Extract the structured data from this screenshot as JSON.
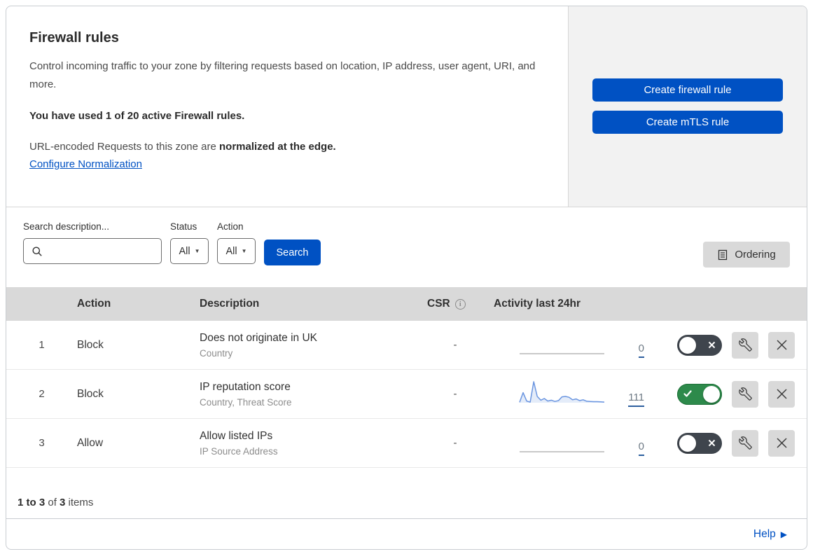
{
  "panel": {
    "title": "Firewall rules",
    "description": "Control incoming traffic to your zone by filtering requests based on location, IP address, user agent, URI, and more.",
    "usage": "You have used 1 of 20 active Firewall rules.",
    "normalization_text": "URL-encoded Requests to this zone are ",
    "normalization_bold": "normalized at the edge.",
    "normalization_link": "Configure Normalization",
    "create_firewall_label": "Create firewall rule",
    "create_mtls_label": "Create mTLS rule"
  },
  "filters": {
    "search_label": "Search description...",
    "status_label": "Status",
    "status_value": "All",
    "action_label": "Action",
    "action_value": "All",
    "search_button": "Search",
    "ordering_button": "Ordering"
  },
  "table": {
    "headers": {
      "action": "Action",
      "description": "Description",
      "csr": "CSR",
      "activity": "Activity last 24hr"
    },
    "rows": [
      {
        "num": "1",
        "action": "Block",
        "title": "Does not originate in UK",
        "subtitle": "Country",
        "csr": "-",
        "count": "0",
        "enabled": false,
        "activity_values": []
      },
      {
        "num": "2",
        "action": "Block",
        "title": "IP reputation score",
        "subtitle": "Country, Threat Score",
        "csr": "-",
        "count": "111",
        "enabled": true,
        "activity_values": [
          2,
          48,
          8,
          3,
          100,
          30,
          12,
          20,
          8,
          12,
          6,
          10,
          28,
          30,
          26,
          14,
          18,
          10,
          14,
          7,
          6,
          5,
          5,
          4,
          3
        ]
      },
      {
        "num": "3",
        "action": "Allow",
        "title": "Allow listed IPs",
        "subtitle": "IP Source Address",
        "csr": "-",
        "count": "0",
        "enabled": false,
        "activity_values": []
      }
    ]
  },
  "footer": {
    "range_bold": "1 to 3",
    "of_text": " of ",
    "total_bold": "3",
    "items_text": " items"
  },
  "help_label": "Help",
  "colors": {
    "accent_blue": "#0051c3",
    "toggle_on_green": "#2d8a4b",
    "toggle_off_gray": "#3f454d",
    "sparkline_blue": "#6a95e0",
    "table_header_gray": "#d9d9d9",
    "side_panel_gray": "#f2f2f2"
  }
}
